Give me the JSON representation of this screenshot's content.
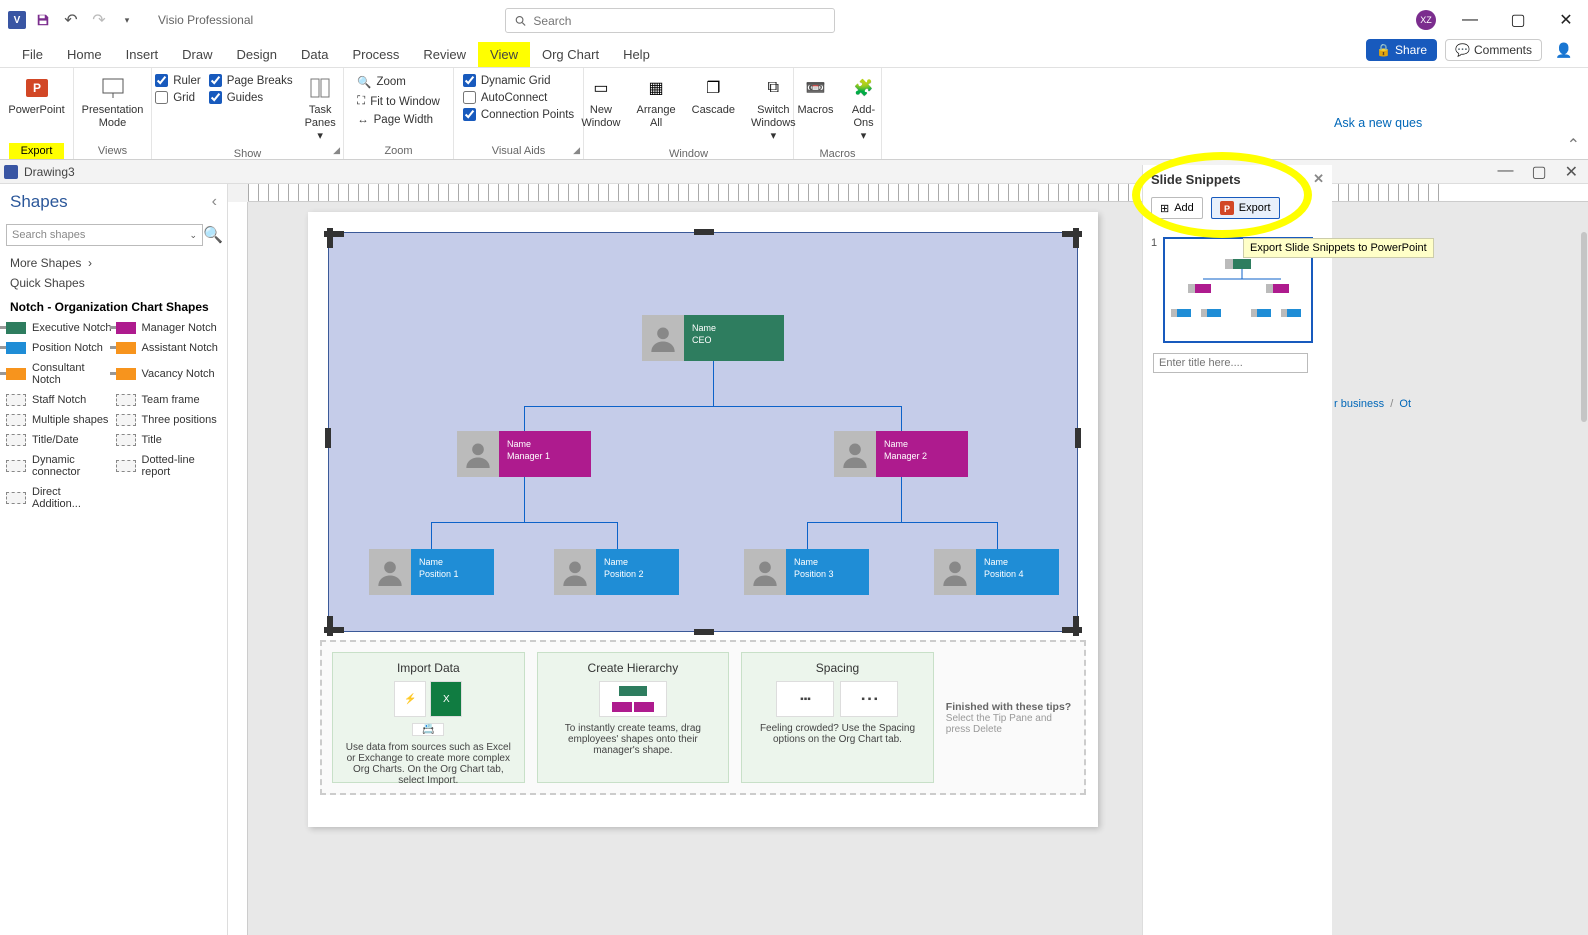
{
  "app": {
    "title": "Visio Professional",
    "avatar_initials": "XZ",
    "search_placeholder": "Search"
  },
  "menu": {
    "tabs": [
      "File",
      "Home",
      "Insert",
      "Draw",
      "Design",
      "Data",
      "Process",
      "Review",
      "View",
      "Org Chart",
      "Help"
    ],
    "active_index": 8,
    "share": "Share",
    "comments": "Comments"
  },
  "ribbon": {
    "export": {
      "big": "PowerPoint",
      "label": "Export"
    },
    "views": {
      "big": "Presentation Mode",
      "label": "Views"
    },
    "show": {
      "ruler": "Ruler",
      "grid": "Grid",
      "page_breaks": "Page Breaks",
      "guides": "Guides",
      "task_panes": "Task Panes",
      "label": "Show"
    },
    "zoom": {
      "zoom": "Zoom",
      "fit": "Fit to Window",
      "page_width": "Page Width",
      "label": "Zoom"
    },
    "visual_aids": {
      "dynamic_grid": "Dynamic Grid",
      "autoconnect": "AutoConnect",
      "connection_points": "Connection Points",
      "label": "Visual Aids"
    },
    "window": {
      "new_window": "New Window",
      "arrange_all": "Arrange All",
      "cascade": "Cascade",
      "switch_windows": "Switch Windows",
      "label": "Window"
    },
    "macros": {
      "macros": "Macros",
      "addons": "Add-Ons",
      "label": "Macros"
    }
  },
  "document": {
    "name": "Drawing3"
  },
  "shapes": {
    "title": "Shapes",
    "search_placeholder": "Search shapes",
    "more_shapes": "More Shapes",
    "quick_shapes": "Quick Shapes",
    "current_category": "Notch - Organization Chart Shapes",
    "items": [
      {
        "label": "Executive Notch",
        "color": "#2e7d5f"
      },
      {
        "label": "Manager Notch",
        "color": "#ae1b8e"
      },
      {
        "label": "Position Notch",
        "color": "#1f8dd6"
      },
      {
        "label": "Assistant Notch",
        "color": "#f7941d"
      },
      {
        "label": "Consultant Notch",
        "color": "#f7941d"
      },
      {
        "label": "Vacancy Notch",
        "color": "#f7941d"
      },
      {
        "label": "Staff Notch",
        "color": "icon"
      },
      {
        "label": "Team frame",
        "color": "icon"
      },
      {
        "label": "Multiple shapes",
        "color": "icon"
      },
      {
        "label": "Three positions",
        "color": "icon"
      },
      {
        "label": "Title/Date",
        "color": "icon"
      },
      {
        "label": "Title",
        "color": "icon"
      },
      {
        "label": "Dynamic connector",
        "color": "icon"
      },
      {
        "label": "Dotted-line report",
        "color": "icon"
      },
      {
        "label": "Direct Addition...",
        "color": "icon"
      }
    ]
  },
  "chart": {
    "ceo": {
      "name": "Name",
      "role": "CEO"
    },
    "m1": {
      "name": "Name",
      "role": "Manager 1"
    },
    "m2": {
      "name": "Name",
      "role": "Manager 2"
    },
    "p1": {
      "name": "Name",
      "role": "Position 1"
    },
    "p2": {
      "name": "Name",
      "role": "Position 2"
    },
    "p3": {
      "name": "Name",
      "role": "Position 3"
    },
    "p4": {
      "name": "Name",
      "role": "Position 4"
    }
  },
  "tips": {
    "import": {
      "title": "Import Data",
      "desc": "Use data from sources such as Excel or Exchange to create more complex Org Charts. On the Org Chart tab, select Import."
    },
    "hierarchy": {
      "title": "Create Hierarchy",
      "desc": "To instantly create teams, drag employees' shapes onto their manager's shape."
    },
    "spacing": {
      "title": "Spacing",
      "desc": "Feeling crowded? Use the Spacing options on the Org Chart tab."
    },
    "finished": {
      "bold": "Finished with these tips?",
      "rest": "Select the Tip Pane and press Delete"
    }
  },
  "snippets": {
    "title": "Slide Snippets",
    "add": "Add",
    "export": "Export",
    "tooltip": "Export Slide Snippets to PowerPoint",
    "slide_num": "1",
    "title_placeholder": "Enter title here...."
  },
  "bg": {
    "ask": "Ask a new ques",
    "crumb1": "r business",
    "crumb2": "Ot"
  }
}
